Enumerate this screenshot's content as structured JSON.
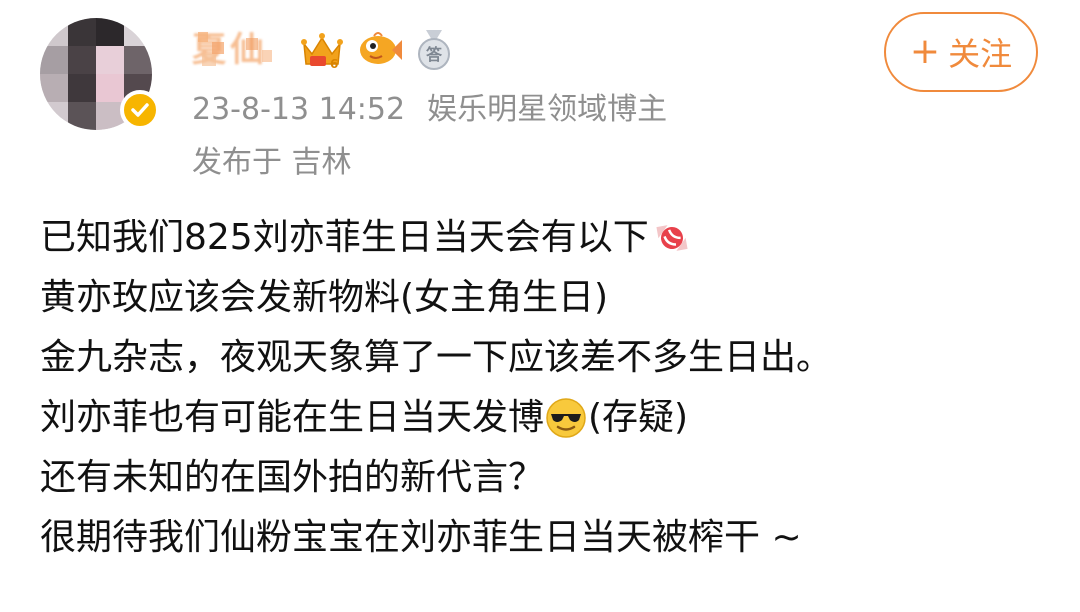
{
  "post": {
    "username": "夏仙",
    "timestamp": "23-8-13 14:52",
    "role": "娱乐明星领域博主",
    "location": "发布于 吉林",
    "follow_label": "关注",
    "follow_plus": "+",
    "lines": {
      "l1": "已知我们825刘亦菲生日当天会有以下",
      "l2": "黄亦玫应该会发新物料(女主角生日)",
      "l3": "金九杂志，夜观天象算了一下应该差不多生日出。",
      "l4a": "刘亦菲也有可能在生日当天发博",
      "l4b": "(存疑)",
      "l5": "还有未知的在国外拍的新代言？",
      "l6": "很期待我们仙粉宝宝在刘亦菲生日当天被榨干 ~"
    },
    "badges": {
      "level_badge_number": "6",
      "answer_badge_char": "答"
    }
  },
  "icons": {
    "verified": "verified-check-icon",
    "level_badge": "crown-level-icon",
    "fish_badge": "fish-icon",
    "answer_badge": "answer-medal-icon",
    "candy": "candy-emoji",
    "sunglasses": "sunglasses-emoji"
  },
  "colors": {
    "accent": "#f08a3c",
    "meta_text": "#8f8f8f",
    "body_text": "#111111",
    "verified_bg": "#f7b500"
  }
}
